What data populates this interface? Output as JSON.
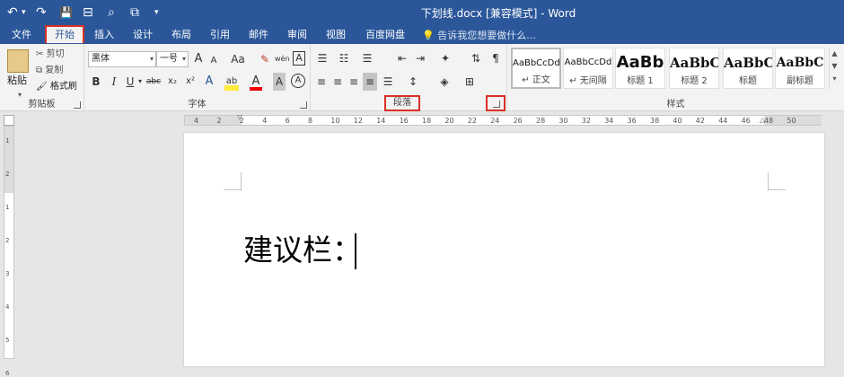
{
  "window": {
    "title": "下划线.docx [兼容模式] - Word"
  },
  "quick_access": {
    "undo": "↶",
    "undo_dd": "▾",
    "redo": "↷",
    "save": "💾",
    "extra1": "⊟",
    "extra2": "⌕",
    "extra3": "⧉",
    "customize": "▾"
  },
  "tabs": [
    {
      "label": "文件"
    },
    {
      "label": "开始"
    },
    {
      "label": "插入"
    },
    {
      "label": "设计"
    },
    {
      "label": "布局"
    },
    {
      "label": "引用"
    },
    {
      "label": "邮件"
    },
    {
      "label": "审阅"
    },
    {
      "label": "视图"
    },
    {
      "label": "百度网盘"
    }
  ],
  "tell_me": "告诉我您想要做什么...",
  "clipboard": {
    "paste": "粘贴",
    "cut": "剪切",
    "copy": "复制",
    "format_painter": "格式刷",
    "label": "剪贴板"
  },
  "font": {
    "name": "黑体",
    "size": "一号",
    "label": "字体",
    "grow": "A",
    "shrink": "A",
    "case": "Aa",
    "clear": "✎",
    "phonetic": "wén",
    "border": "A",
    "bold": "B",
    "italic": "I",
    "underline": "U",
    "strike": "abc",
    "sub": "x₂",
    "sup": "x²",
    "effects": "A",
    "highlight": "ab",
    "color": "A",
    "shade": "A",
    "circle": "A"
  },
  "paragraph": {
    "label": "段落"
  },
  "styles": {
    "label": "样式",
    "items": [
      {
        "sample": "AaBbCcDd",
        "name": "↵ 正文"
      },
      {
        "sample": "AaBbCcDd",
        "name": "↵ 无间隔"
      },
      {
        "sample": "AaBb",
        "name": "标题 1"
      },
      {
        "sample": "AaBbC",
        "name": "标题 2"
      },
      {
        "sample": "AaBbC",
        "name": "标题"
      },
      {
        "sample": "AaBbC",
        "name": "副标题"
      }
    ]
  },
  "ruler": {
    "numbers": [
      "4",
      "2",
      "2",
      "4",
      "6",
      "8",
      "10",
      "12",
      "14",
      "16",
      "18",
      "20",
      "22",
      "24",
      "26",
      "28",
      "30",
      "32",
      "34",
      "36",
      "38",
      "40",
      "42",
      "44",
      "46",
      "48",
      "50"
    ]
  },
  "vruler": {
    "numbers": [
      "1",
      "2",
      "1",
      "2",
      "3",
      "4",
      "5",
      "6"
    ]
  },
  "document": {
    "text": "建议栏："
  },
  "colors": {
    "accent": "#2b579a",
    "highlight_box": "#d93025"
  }
}
